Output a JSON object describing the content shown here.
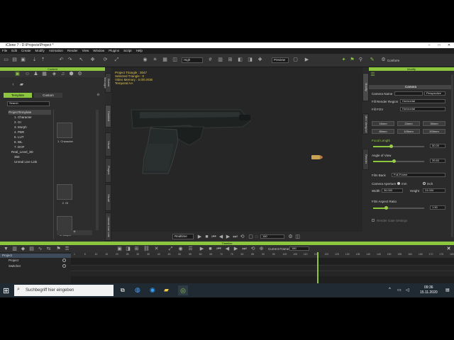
{
  "app": {
    "title": "iClone 7 - D:\\Projects\\Project *",
    "window_controls": [
      "–",
      "□",
      "✕"
    ]
  },
  "menu": [
    "File",
    "Edit",
    "Create",
    "Modify",
    "Animation",
    "Render",
    "View",
    "Window",
    "Plugins",
    "Script",
    "Help"
  ],
  "toolbar": {
    "quality": "High",
    "preview": "Preview",
    "conform_label": "Conform"
  },
  "content_panel": {
    "title": "Content",
    "tabs": [
      "Template",
      "Custom"
    ],
    "search_placeholder": "Search",
    "tree": [
      "ProjectTemplate",
      "1. Character",
      "2. GI",
      "3. Morph",
      "4. PBR",
      "5. LUT",
      "6. IBL",
      "7. DOF",
      "Real_Level_3D",
      "360",
      "Unreal Live Link"
    ],
    "thumbs": [
      "1. Character",
      "2. GI",
      "3. Morph",
      "4. PBR"
    ],
    "add_label": "+"
  },
  "side_tabs": [
    "Scene Manager",
    "Content",
    "Visual",
    "Project",
    "Visual",
    "Project",
    "Unreal Live Link"
  ],
  "viewport": {
    "info": [
      "Project Triangle : 3047",
      "Selected Triangle : 0",
      "Video Memory : 0.0/0.0GB",
      "Temporal AA"
    ]
  },
  "playbar": {
    "mode": "Realtime",
    "frame": "180"
  },
  "modify": {
    "title": "Modify",
    "section": "Camera",
    "camera_name_label": "Camera Name",
    "camera_name_value": "",
    "camera_type": "Perspective",
    "fill_render_label": "Fill Render Region",
    "fill_render_value": "Horizontal",
    "fill_fov_label": "Fill FOV",
    "fill_fov_value": "Horizontal",
    "lens_buttons": [
      "16mm",
      "24mm",
      "35mm",
      "85mm",
      "105mm",
      "200mm"
    ],
    "focal_length_label": "Focal Length",
    "focal_length_value": "50.00",
    "angle_label": "Angle of View",
    "angle_value": "39.60",
    "film_back_label": "Film Back",
    "film_back_value": "Full-Frame",
    "aperture_label": "Camera Aperture",
    "aperture_mm": "mm",
    "aperture_inch": "inch",
    "width_label": "Width",
    "width_value": "36.000",
    "height_label": "Height",
    "height_value": "24.000",
    "film_ratio_label": "Film Aspect Ratio",
    "film_ratio_value": "1.50",
    "gate_label": "Render Gate Settings",
    "focal_length_ratio": 0.35,
    "angle_ratio": 0.4,
    "film_ratio": 0.25
  },
  "side_tabs_right": [
    "Modify",
    "Attribute",
    "Visual",
    "Mini Viewport",
    "Render"
  ],
  "timeline": {
    "title": "Timeline",
    "current_frame_label": "Current Frame:",
    "current_frame_value": "180",
    "tracks": [
      "Project",
      "Project",
      "Switcher"
    ],
    "ruler": [
      "1",
      "5",
      "10",
      "15",
      "20",
      "25",
      "30",
      "35",
      "40",
      "45",
      "50",
      "55",
      "60",
      "65",
      "70",
      "75",
      "80",
      "85",
      "90",
      "95",
      "100",
      "105",
      "110",
      "115",
      "120",
      "125",
      "130",
      "135",
      "140",
      "145",
      "150",
      "155",
      "160",
      "165",
      "170",
      "175",
      "180"
    ]
  },
  "taskbar": {
    "search_placeholder": "Suchbegriff hier eingeben",
    "time": "09:36",
    "date": "15.11.2020"
  },
  "colors": {
    "accent": "#8cc63f",
    "info_text": "#e6c84a"
  }
}
